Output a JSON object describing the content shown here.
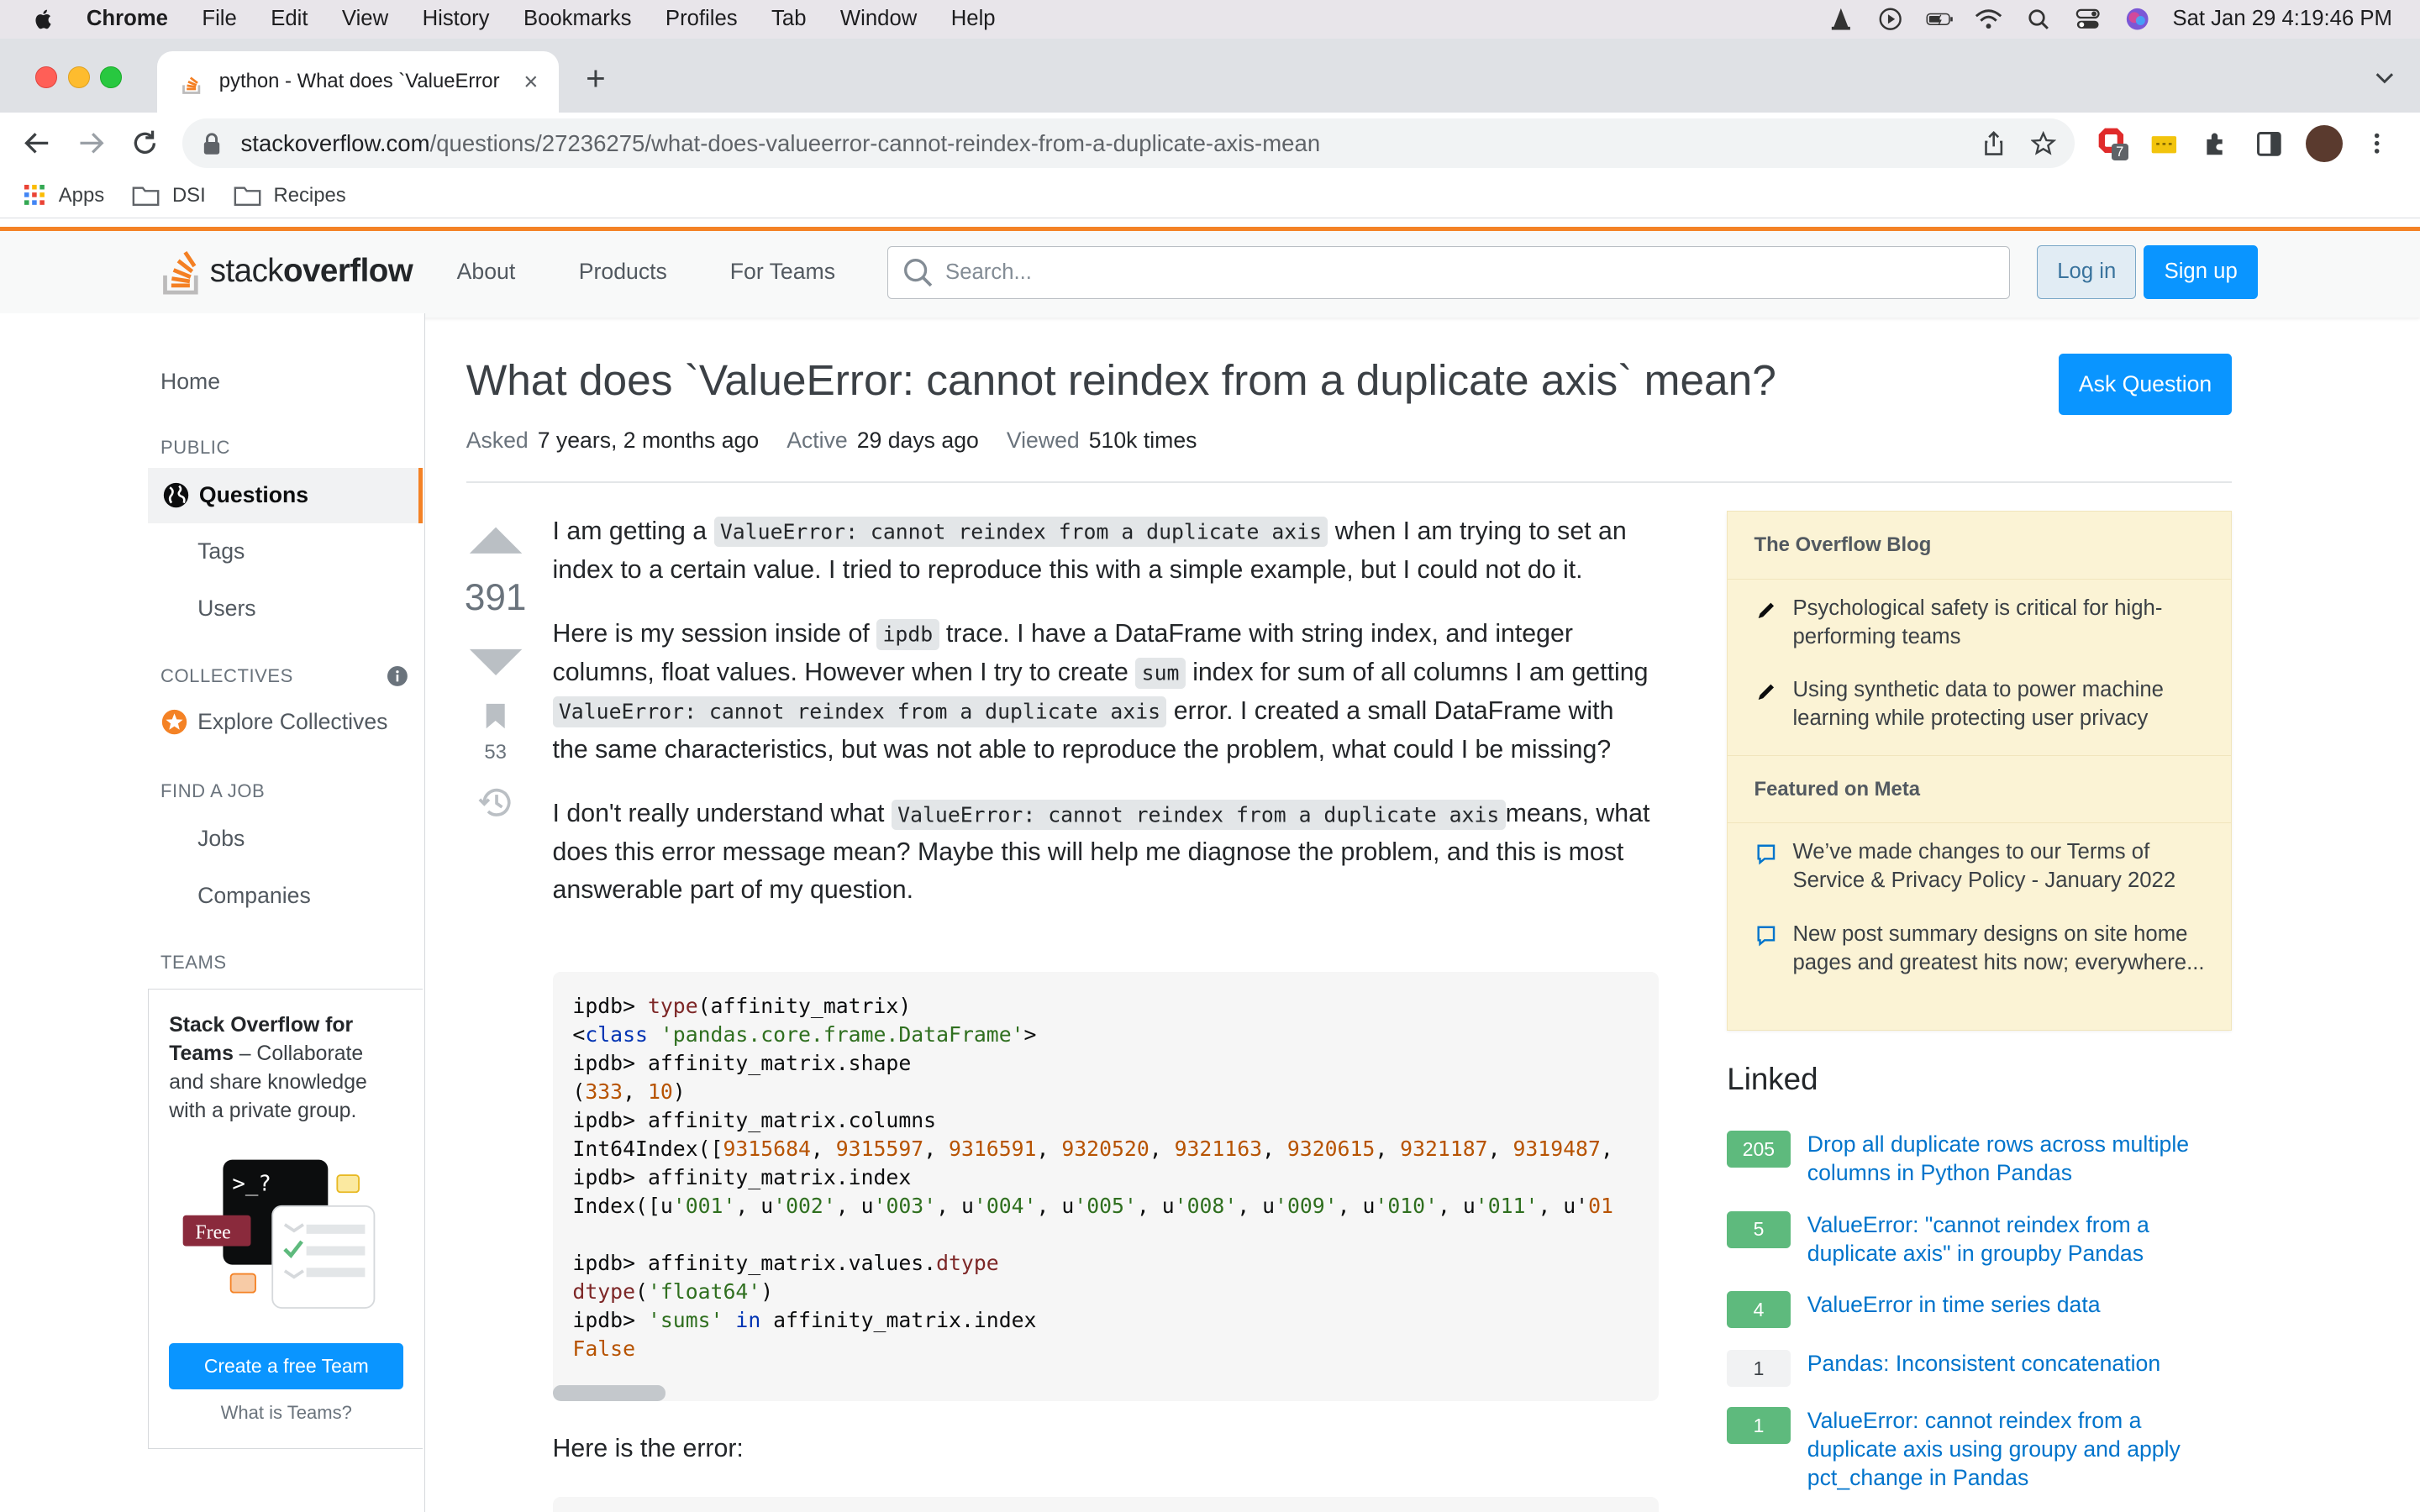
{
  "menubar": {
    "app": "Chrome",
    "items": [
      "File",
      "Edit",
      "View",
      "History",
      "Bookmarks",
      "Profiles",
      "Tab",
      "Window",
      "Help"
    ],
    "datetime": "Sat Jan 29  4:19:46 PM"
  },
  "browser": {
    "tab_title": "python - What does `ValueError",
    "url_host": "stackoverflow.com",
    "url_path": "/questions/27236275/what-does-valueerror-cannot-reindex-from-a-duplicate-axis-mean",
    "extension_badge": "7",
    "bookmarks": [
      "Apps",
      "DSI",
      "Recipes"
    ]
  },
  "so": {
    "logo_light": "stack",
    "logo_bold": "overflow",
    "nav": [
      "About",
      "Products",
      "For Teams"
    ],
    "search_placeholder": "Search...",
    "login": "Log in",
    "signup": "Sign up"
  },
  "sidebar": {
    "home": "Home",
    "public_header": "PUBLIC",
    "questions": "Questions",
    "tags": "Tags",
    "users": "Users",
    "collectives_header": "COLLECTIVES",
    "explore_collectives": "Explore Collectives",
    "find_job_header": "FIND A JOB",
    "jobs": "Jobs",
    "companies": "Companies",
    "teams_header": "TEAMS",
    "teams_title": "Stack Overflow for Teams",
    "teams_desc": " – Collaborate and share knowledge with a private group.",
    "free_badge": "Free",
    "terminal_text": ">_?",
    "create_team": "Create a free Team",
    "what_is_teams": "What is Teams?"
  },
  "question": {
    "title": "What does `ValueError: cannot reindex from a duplicate axis` mean?",
    "ask_button": "Ask Question",
    "asked_label": "Asked",
    "asked_value": "7 years, 2 months ago",
    "active_label": "Active",
    "active_value": "29 days ago",
    "viewed_label": "Viewed",
    "viewed_value": "510k times",
    "votes": "391",
    "bookmarks": "53",
    "p1_a": "I am getting a ",
    "p1_code": "ValueError: cannot reindex from a duplicate axis",
    "p1_b": " when I am trying to set an index to a certain value. I tried to reproduce this with a simple example, but I could not do it.",
    "p2_a": "Here is my session inside of ",
    "p2_code1": "ipdb",
    "p2_b": " trace. I have a DataFrame with string index, and integer columns, float values. However when I try to create ",
    "p2_code2": "sum",
    "p2_c": " index for sum of all columns I am getting ",
    "p2_code3": "ValueError: cannot reindex from a duplicate axis",
    "p2_d": " error. I created a small DataFrame with the same characteristics, but was not able to reproduce the problem, what could I be missing?",
    "p3_a": "I don't really understand what ",
    "p3_code": "ValueError: cannot reindex from a duplicate axis",
    "p3_b": "means, what does this error message mean? Maybe this will help me diagnose the problem, and this is most answerable part of my question.",
    "code_lines": [
      "ipdb> type(affinity_matrix)",
      "<class 'pandas.core.frame.DataFrame'>",
      "ipdb> affinity_matrix.shape",
      "(333, 10)",
      "ipdb> affinity_matrix.columns",
      "Int64Index([9315684, 9315597, 9316591, 9320520, 9321163, 9320615, 9321187, 9319487,",
      "ipdb> affinity_matrix.index",
      "Index([u'001', u'002', u'003', u'004', u'005', u'008', u'009', u'010', u'011', u'01",
      "",
      "ipdb> affinity_matrix.values.dtype",
      "dtype('float64')",
      "ipdb> 'sums' in affinity_matrix.index",
      "False"
    ],
    "here_error": "Here is the error:"
  },
  "blog": {
    "header": "The Overflow Blog",
    "items": [
      "Psychological safety is critical for high-performing teams",
      "Using synthetic data to power machine learning while protecting user privacy"
    ],
    "meta_header": "Featured on Meta",
    "meta_items": [
      "We’ve made changes to our Terms of Service & Privacy Policy - January 2022",
      "New post summary designs on site home pages and greatest hits now; everywhere..."
    ]
  },
  "linked": {
    "title": "Linked",
    "items": [
      {
        "score": "205",
        "accepted": true,
        "text": "Drop all duplicate rows across multiple columns in Python Pandas"
      },
      {
        "score": "5",
        "accepted": true,
        "text": "ValueError: \"cannot reindex from a duplicate axis\" in groupby Pandas"
      },
      {
        "score": "4",
        "accepted": true,
        "text": "ValueError in time series data"
      },
      {
        "score": "1",
        "accepted": false,
        "text": "Pandas: Inconsistent concatenation"
      },
      {
        "score": "1",
        "accepted": true,
        "text": "ValueError: cannot reindex from a duplicate axis using groupy and apply pct_change in Pandas"
      }
    ]
  },
  "colors": {
    "so_orange": "#f48225",
    "so_blue": "#0a95ff",
    "accepted_green": "#5eba7d",
    "link_blue": "#0074cc"
  }
}
